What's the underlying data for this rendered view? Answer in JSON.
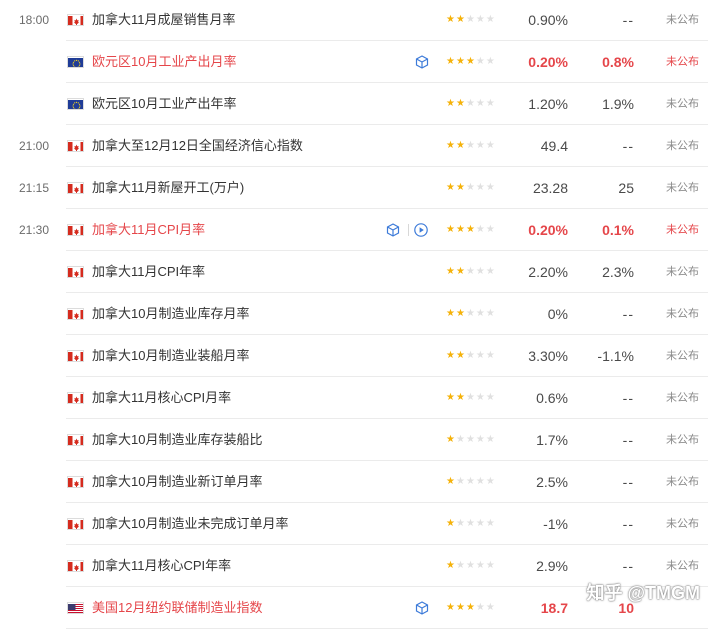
{
  "rows": [
    {
      "time": "18:00",
      "flag": "ca",
      "title": "加拿大11月成屋销售月率",
      "stars": 2,
      "previous": "0.90%",
      "consensus": "--",
      "actual": "未公布",
      "highlight": false,
      "icons": []
    },
    {
      "time": "",
      "flag": "eu",
      "title": "欧元区10月工业产出月率",
      "stars": 3,
      "previous": "0.20%",
      "consensus": "0.8%",
      "actual": "未公布",
      "highlight": true,
      "icons": [
        "cube-icon"
      ]
    },
    {
      "time": "",
      "flag": "eu",
      "title": "欧元区10月工业产出年率",
      "stars": 2,
      "previous": "1.20%",
      "consensus": "1.9%",
      "actual": "未公布",
      "highlight": false,
      "icons": []
    },
    {
      "time": "21:00",
      "flag": "ca",
      "title": "加拿大至12月12日全国经济信心指数",
      "stars": 2,
      "previous": "49.4",
      "consensus": "--",
      "actual": "未公布",
      "highlight": false,
      "icons": []
    },
    {
      "time": "21:15",
      "flag": "ca",
      "title": "加拿大11月新屋开工(万户)",
      "stars": 2,
      "previous": "23.28",
      "consensus": "25",
      "actual": "未公布",
      "highlight": false,
      "icons": []
    },
    {
      "time": "21:30",
      "flag": "ca",
      "title": "加拿大11月CPI月率",
      "stars": 3,
      "previous": "0.20%",
      "consensus": "0.1%",
      "actual": "未公布",
      "highlight": true,
      "icons": [
        "cube-icon",
        "play-icon"
      ]
    },
    {
      "time": "",
      "flag": "ca",
      "title": "加拿大11月CPI年率",
      "stars": 2,
      "previous": "2.20%",
      "consensus": "2.3%",
      "actual": "未公布",
      "highlight": false,
      "icons": []
    },
    {
      "time": "",
      "flag": "ca",
      "title": "加拿大10月制造业库存月率",
      "stars": 2,
      "previous": "0%",
      "consensus": "--",
      "actual": "未公布",
      "highlight": false,
      "icons": []
    },
    {
      "time": "",
      "flag": "ca",
      "title": "加拿大10月制造业装船月率",
      "stars": 2,
      "previous": "3.30%",
      "consensus": "-1.1%",
      "actual": "未公布",
      "highlight": false,
      "icons": []
    },
    {
      "time": "",
      "flag": "ca",
      "title": "加拿大11月核心CPI月率",
      "stars": 2,
      "previous": "0.6%",
      "consensus": "--",
      "actual": "未公布",
      "highlight": false,
      "icons": []
    },
    {
      "time": "",
      "flag": "ca",
      "title": "加拿大10月制造业库存装船比",
      "stars": 1,
      "previous": "1.7%",
      "consensus": "--",
      "actual": "未公布",
      "highlight": false,
      "icons": []
    },
    {
      "time": "",
      "flag": "ca",
      "title": "加拿大10月制造业新订单月率",
      "stars": 1,
      "previous": "2.5%",
      "consensus": "--",
      "actual": "未公布",
      "highlight": false,
      "icons": []
    },
    {
      "time": "",
      "flag": "ca",
      "title": "加拿大10月制造业未完成订单月率",
      "stars": 1,
      "previous": "-1%",
      "consensus": "--",
      "actual": "未公布",
      "highlight": false,
      "icons": []
    },
    {
      "time": "",
      "flag": "ca",
      "title": "加拿大11月核心CPI年率",
      "stars": 1,
      "previous": "2.9%",
      "consensus": "--",
      "actual": "未公布",
      "highlight": false,
      "icons": []
    },
    {
      "time": "",
      "flag": "us",
      "title": "美国12月纽约联储制造业指数",
      "stars": 3,
      "previous": "18.7",
      "consensus": "10",
      "actual": "",
      "highlight": true,
      "icons": [
        "cube-icon"
      ]
    }
  ],
  "watermark": "知乎 @TMGM",
  "colors": {
    "highlight": "#e5464a",
    "star": "#f5b20a",
    "text": "#333333",
    "divider": "#ebebeb"
  }
}
